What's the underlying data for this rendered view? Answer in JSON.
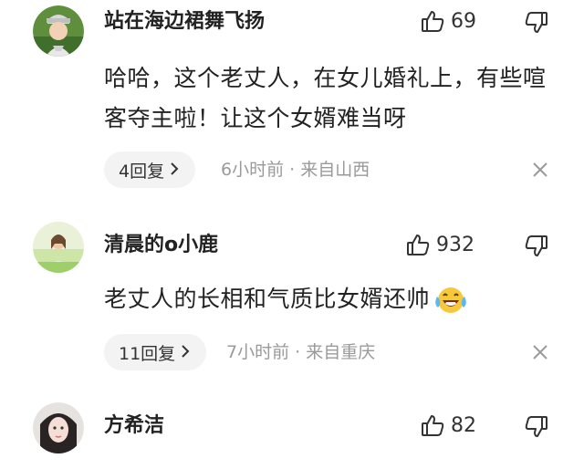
{
  "comments": [
    {
      "username": "站在海边裙舞飞扬",
      "likes": "69",
      "text": "哈哈，这个老丈人，在女儿婚礼上，有些喧客夺主啦！让这个女婿难当呀",
      "replies": "4回复",
      "time": "6小时前",
      "location": "来自山西"
    },
    {
      "username": "清晨的o小鹿",
      "likes": "932",
      "text": "老丈人的长相和气质比女婿还帅",
      "replies": "11回复",
      "time": "7小时前",
      "location": "来自重庆"
    },
    {
      "username": "方希洁",
      "likes": "82"
    }
  ],
  "icons": {
    "like": "thumbs-up-icon",
    "dislike": "thumbs-down-icon",
    "chevron": "chevron-right-icon",
    "close": "close-icon",
    "emoji": "laughing-tears-emoji"
  },
  "meta_separator": "·"
}
